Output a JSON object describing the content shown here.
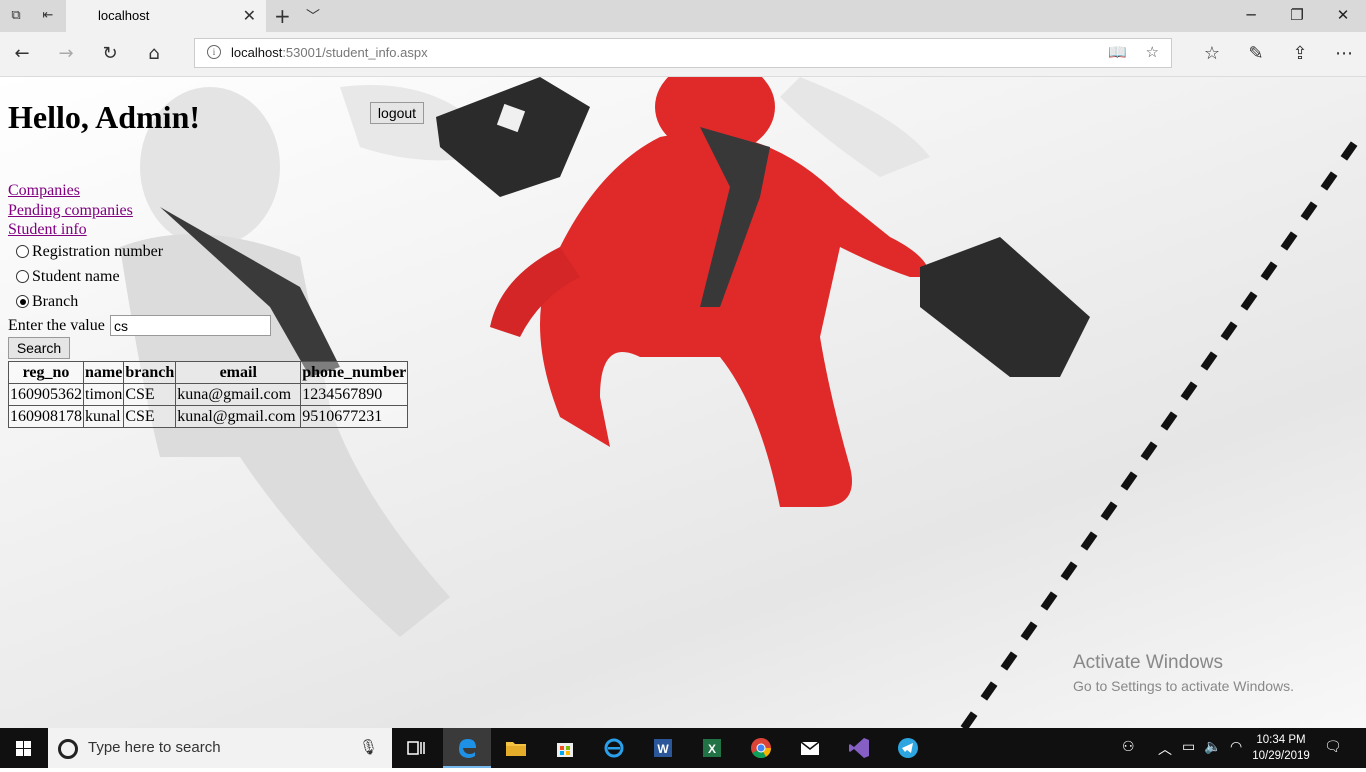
{
  "browser": {
    "tab_title": "localhost",
    "url_host": "localhost",
    "url_path": ":53001/student_info.aspx"
  },
  "page": {
    "greeting": "Hello, Admin!",
    "logout_label": "logout",
    "nav_links": [
      "Companies",
      "Pending companies",
      "Student info"
    ],
    "search_options": [
      {
        "label": "Registration number",
        "checked": false
      },
      {
        "label": "Student name",
        "checked": false
      },
      {
        "label": "Branch",
        "checked": true
      }
    ],
    "enter_label": "Enter the value",
    "input_value": "cs",
    "search_label": "Search",
    "table": {
      "headers": [
        "reg_no",
        "name",
        "branch",
        "email",
        "phone_number"
      ],
      "rows": [
        [
          "160905362",
          "timon",
          "CSE",
          "kuna@gmail.com",
          "1234567890"
        ],
        [
          "160908178",
          "kunal",
          "CSE",
          "kunal@gmail.com",
          "9510677231"
        ]
      ]
    }
  },
  "watermark": {
    "title": "Activate Windows",
    "subtitle": "Go to Settings to activate Windows."
  },
  "taskbar": {
    "search_placeholder": "Type here to search",
    "time": "10:34 PM",
    "date": "10/29/2019"
  }
}
